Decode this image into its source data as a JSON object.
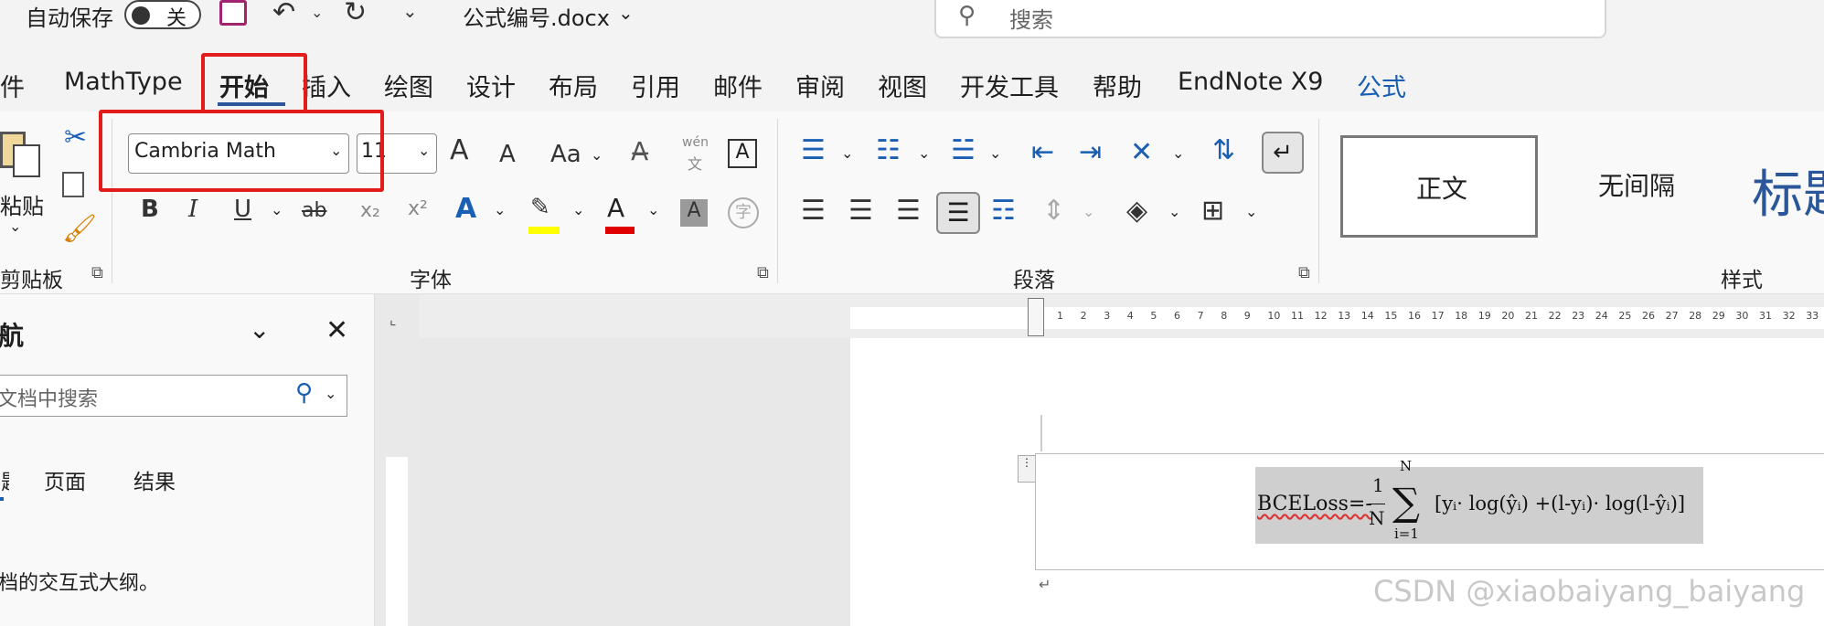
{
  "titlebar": {
    "autosave_label": "自动保存",
    "autosave_state": "关",
    "filename": "公式编号.docx",
    "search_placeholder": "搜索"
  },
  "tabs": [
    "件",
    "MathType",
    "开始",
    "插入",
    "绘图",
    "设计",
    "布局",
    "引用",
    "邮件",
    "审阅",
    "视图",
    "开发工具",
    "帮助",
    "EndNote X9",
    "公式"
  ],
  "active_tab": "开始",
  "ribbon": {
    "clipboard": {
      "paste_label": "粘贴",
      "group_label": "剪贴板"
    },
    "font": {
      "font_name": "Cambria Math",
      "font_size": "11",
      "group_label": "字体",
      "grow_label": "A",
      "shrink_label": "A",
      "case_label": "Aa",
      "phonetic_top": "wén",
      "phonetic_bottom": "文",
      "border_char": "A",
      "bold": "B",
      "italic": "I",
      "underline": "U",
      "strike": "ab",
      "subscript": "x₂",
      "superscript": "x²",
      "shade_char": "A",
      "enclose_char": "字"
    },
    "paragraph": {
      "group_label": "段落"
    },
    "styles": {
      "group_label": "样式",
      "items": [
        "正文",
        "无间隔",
        "标题"
      ]
    }
  },
  "navpane": {
    "title": "导航",
    "search_placeholder": "在文档中搜索",
    "tabs": [
      "标题",
      "页面",
      "结果"
    ],
    "message": "文档的交互式大纲。"
  },
  "ruler_numbers": [
    "1",
    "2",
    "3",
    "4",
    "5",
    "6",
    "7",
    "8",
    "9",
    "10",
    "11",
    "12",
    "13",
    "14",
    "15",
    "16",
    "17",
    "18",
    "19",
    "20",
    "21",
    "22",
    "23",
    "24",
    "25",
    "26",
    "27",
    "28",
    "29",
    "30",
    "31",
    "32",
    "33"
  ],
  "equation": {
    "text": "BCELoss=-",
    "frac_num": "1",
    "frac_den": "N",
    "sum_upper": "N",
    "sum_lower": "i=1",
    "body": "[yᵢ· log(ŷᵢ) +(l-yᵢ)· log(l-ŷᵢ)]"
  },
  "watermark": "CSDN @xiaobaiyang_baiyang"
}
